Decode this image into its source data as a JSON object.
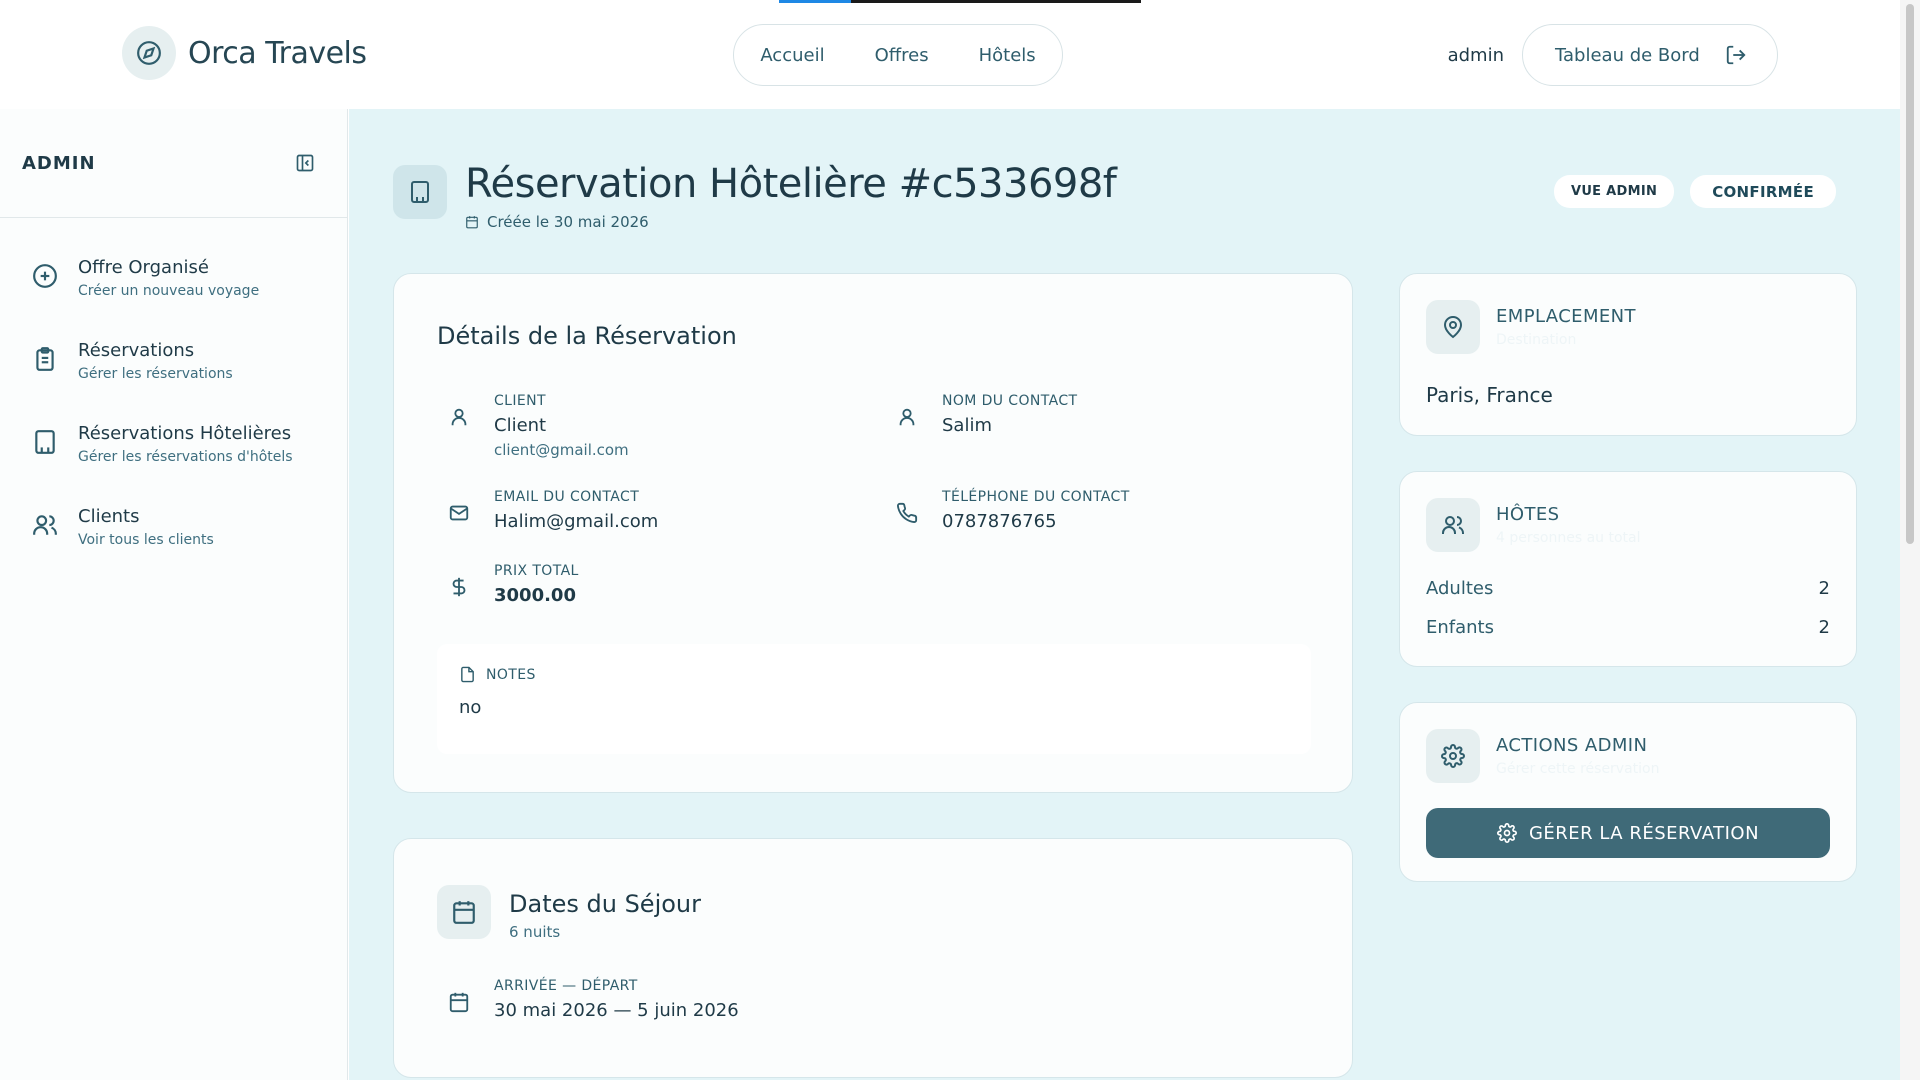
{
  "header": {
    "brand": "Orca Travels",
    "nav": [
      "Accueil",
      "Offres",
      "Hôtels"
    ],
    "username": "admin",
    "dashboard_label": "Tableau de Bord"
  },
  "sidebar": {
    "title": "ADMIN",
    "items": [
      {
        "label": "Offre Organisé",
        "sub": "Créer un nouveau voyage",
        "icon": "plus-circle-icon"
      },
      {
        "label": "Réservations",
        "sub": "Gérer les réservations",
        "icon": "clipboard-icon"
      },
      {
        "label": "Réservations Hôtelières",
        "sub": "Gérer les réservations d'hôtels",
        "icon": "building-icon"
      },
      {
        "label": "Clients",
        "sub": "Voir tous les clients",
        "icon": "users-icon"
      }
    ]
  },
  "page": {
    "title": "Réservation Hôtelière #c533698f",
    "created": "Créée le 30 mai 2026",
    "badges": {
      "admin": "VUE ADMIN",
      "status": "CONFIRMÉE"
    }
  },
  "details": {
    "title": "Détails de la Réservation",
    "client": {
      "label": "CLIENT",
      "value": "Client",
      "email": "client@gmail.com"
    },
    "contact_name": {
      "label": "NOM DU CONTACT",
      "value": "Salim"
    },
    "contact_email": {
      "label": "EMAIL DU CONTACT",
      "value": "Halim@gmail.com"
    },
    "contact_phone": {
      "label": "TÉLÉPHONE DU CONTACT",
      "value": "0787876765"
    },
    "total_price": {
      "label": "PRIX TOTAL",
      "value": "3000.00"
    },
    "notes": {
      "label": "NOTES",
      "value": "no"
    }
  },
  "dates": {
    "title": "Dates du Séjour",
    "nights": "6 nuits",
    "range_label": "ARRIVÉE — DÉPART",
    "range_value": "30 mai 2026 — 5 juin 2026"
  },
  "location": {
    "title": "EMPLACEMENT",
    "sub": "Destination",
    "value": "Paris, France"
  },
  "hosts": {
    "title": "HÔTES",
    "sub": "4 personnes au total",
    "adults_label": "Adultes",
    "adults": "2",
    "children_label": "Enfants",
    "children": "2"
  },
  "admin_actions": {
    "title": "ACTIONS ADMIN",
    "sub": "Gérer cette réservation",
    "button": "GÉRER LA RÉSERVATION"
  },
  "colors": {
    "accent": "#3f6a78",
    "main_bg": "#e3f4f7",
    "progress": "#1e88e5"
  }
}
